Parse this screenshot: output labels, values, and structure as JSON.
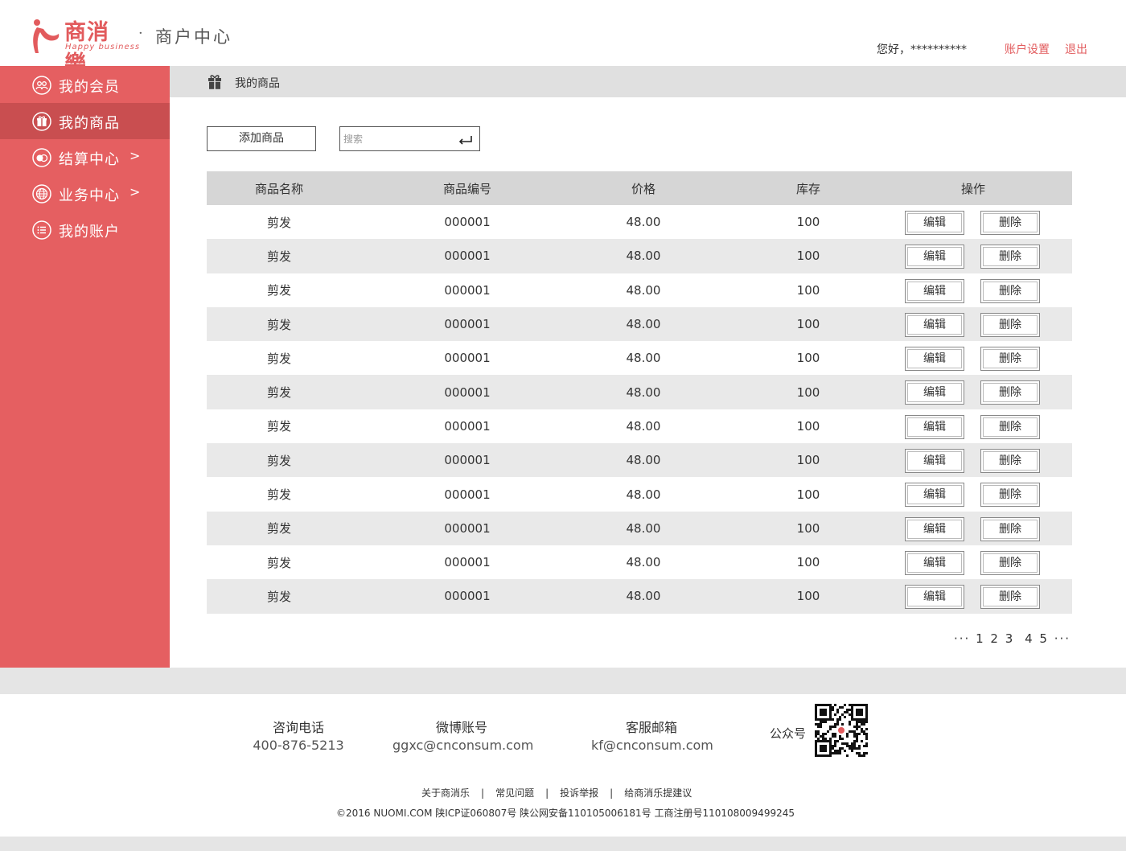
{
  "header": {
    "logo_title": "商消樂",
    "logo_subtitle": "Happy business",
    "dot": "·",
    "subtitle": "商户中心",
    "greeting": "您好，**********",
    "account_settings": "账户设置",
    "logout": "退出",
    "accent_color": "#e25b5d"
  },
  "sidebar": {
    "background": "#e55f61",
    "active_background": "#c94e50",
    "items": [
      {
        "label": "我的会员",
        "icon": "members-icon",
        "arrow": ""
      },
      {
        "label": "我的商品",
        "icon": "gift-icon",
        "arrow": "",
        "active": true
      },
      {
        "label": "结算中心",
        "icon": "settlement-icon",
        "arrow": ">"
      },
      {
        "label": "业务中心",
        "icon": "globe-icon",
        "arrow": ">"
      },
      {
        "label": "我的账户",
        "icon": "list-icon",
        "arrow": ""
      }
    ]
  },
  "main": {
    "title": "我的商品",
    "add_button": "添加商品",
    "search_placeholder": "搜索",
    "table": {
      "headers": [
        "商品名称",
        "商品编号",
        "价格",
        "库存",
        "操作"
      ],
      "edit_label": "编辑",
      "delete_label": "删除",
      "rows": [
        [
          "剪发",
          "000001",
          "48.00",
          "100"
        ],
        [
          "剪发",
          "000001",
          "48.00",
          "100"
        ],
        [
          "剪发",
          "000001",
          "48.00",
          "100"
        ],
        [
          "剪发",
          "000001",
          "48.00",
          "100"
        ],
        [
          "剪发",
          "000001",
          "48.00",
          "100"
        ],
        [
          "剪发",
          "000001",
          "48.00",
          "100"
        ],
        [
          "剪发",
          "000001",
          "48.00",
          "100"
        ],
        [
          "剪发",
          "000001",
          "48.00",
          "100"
        ],
        [
          "剪发",
          "000001",
          "48.00",
          "100"
        ],
        [
          "剪发",
          "000001",
          "48.00",
          "100"
        ],
        [
          "剪发",
          "000001",
          "48.00",
          "100"
        ],
        [
          "剪发",
          "000001",
          "48.00",
          "100"
        ]
      ]
    },
    "pagination": {
      "prev": "···",
      "pages": [
        "1",
        "2",
        "3",
        "4",
        "5"
      ],
      "next": "···"
    }
  },
  "footer": {
    "phone_label": "咨询电话",
    "phone_value": "400-876-5213",
    "weibo_label": "微博账号",
    "weibo_value": "ggxc@cnconsum.com",
    "mail_label": "客服邮箱",
    "mail_value": "kf@cnconsum.com",
    "gzh_label": "公众号",
    "links": [
      "关于商消乐",
      "常见问题",
      "投诉举报",
      "给商消乐提建议"
    ],
    "separator": "|",
    "copyright": "©2016 NUOMI.COM 陕ICP证060807号 陕公网安备110105006181号 工商注册号110108009499245"
  }
}
